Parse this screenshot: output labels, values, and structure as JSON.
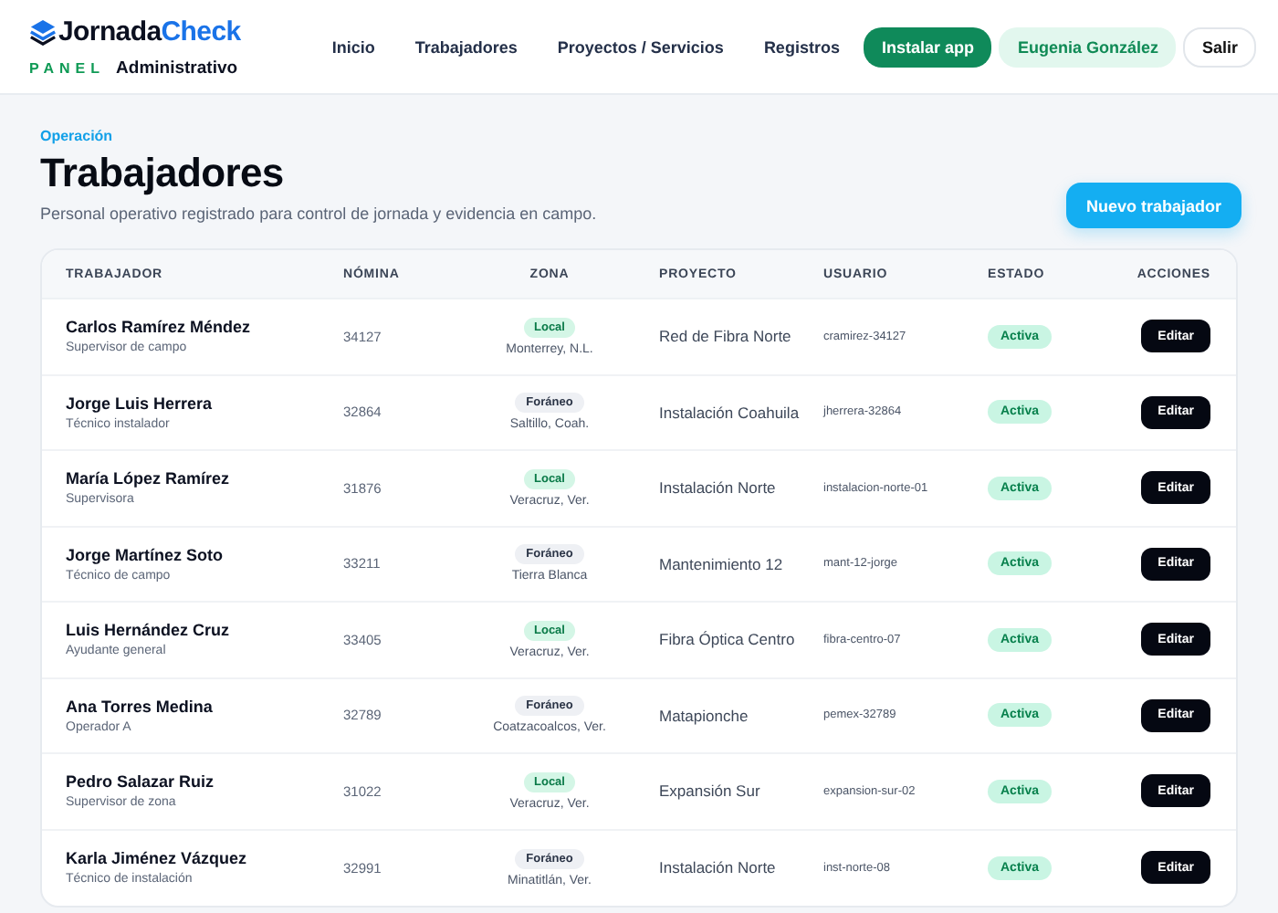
{
  "brand": {
    "name_start": "Jornada",
    "name_end": "Check",
    "panel": "PANEL",
    "subtitle": "Administrativo"
  },
  "nav": [
    {
      "label": "Inicio",
      "kind": "link"
    },
    {
      "label": "Trabajadores",
      "kind": "link"
    },
    {
      "label": "Proyectos / Servicios",
      "kind": "link"
    },
    {
      "label": "Registros",
      "kind": "link"
    },
    {
      "label": "Instalar app",
      "kind": "primary"
    },
    {
      "label": "Eugenia González",
      "kind": "user"
    },
    {
      "label": "Salir",
      "kind": "outline"
    }
  ],
  "page": {
    "eyebrow": "Operación",
    "title": "Trabajadores",
    "description": "Personal operativo registrado para control de jornada y evidencia en campo.",
    "action": "Nuevo trabajador"
  },
  "table": {
    "columns": [
      "TRABAJADOR",
      "NÓMINA",
      "ZONA",
      "PROYECTO",
      "USUARIO",
      "ESTADO",
      "ACCIONES"
    ],
    "rows": [
      {
        "name": "Carlos Ramírez Méndez",
        "role": "Supervisor de campo",
        "payroll": "34127",
        "zone": {
          "label": "Local",
          "kind": "local"
        },
        "place": "Monterrey, N.L.",
        "project": "Red de Fibra Norte",
        "user": "cramirez-34127",
        "status": {
          "label": "Activa",
          "kind": "active"
        },
        "action": "Editar"
      },
      {
        "name": "Jorge Luis Herrera",
        "role": "Técnico instalador",
        "payroll": "32864",
        "zone": {
          "label": "Foráneo",
          "kind": "foreign"
        },
        "place": "Saltillo, Coah.",
        "project": "Instalación Coahuila",
        "user": "jherrera-32864",
        "status": {
          "label": "Activa",
          "kind": "active"
        },
        "action": "Editar"
      },
      {
        "name": "María López Ramírez",
        "role": "Supervisora",
        "payroll": "31876",
        "zone": {
          "label": "Local",
          "kind": "local"
        },
        "place": "Veracruz, Ver.",
        "project": "Instalación Norte",
        "user": "instalacion-norte-01",
        "status": {
          "label": "Activa",
          "kind": "active"
        },
        "action": "Editar"
      },
      {
        "name": "Jorge Martínez Soto",
        "role": "Técnico de campo",
        "payroll": "33211",
        "zone": {
          "label": "Foráneo",
          "kind": "foreign"
        },
        "place": "Tierra Blanca",
        "project": "Mantenimiento 12",
        "user": "mant-12-jorge",
        "status": {
          "label": "Activa",
          "kind": "active"
        },
        "action": "Editar"
      },
      {
        "name": "Luis Hernández Cruz",
        "role": "Ayudante general",
        "payroll": "33405",
        "zone": {
          "label": "Local",
          "kind": "local"
        },
        "place": "Veracruz, Ver.",
        "project": "Fibra Óptica Centro",
        "user": "fibra-centro-07",
        "status": {
          "label": "Activa",
          "kind": "active"
        },
        "action": "Editar"
      },
      {
        "name": "Ana Torres Medina",
        "role": "Operador A",
        "payroll": "32789",
        "zone": {
          "label": "Foráneo",
          "kind": "foreign"
        },
        "place": "Coatzacoalcos, Ver.",
        "project": "Matapionche",
        "user": "pemex-32789",
        "status": {
          "label": "Activa",
          "kind": "active"
        },
        "action": "Editar"
      },
      {
        "name": "Pedro Salazar Ruiz",
        "role": "Supervisor de zona",
        "payroll": "31022",
        "zone": {
          "label": "Local",
          "kind": "local"
        },
        "place": "Veracruz, Ver.",
        "project": "Expansión Sur",
        "user": "expansion-sur-02",
        "status": {
          "label": "Activa",
          "kind": "active"
        },
        "action": "Editar"
      },
      {
        "name": "Karla Jiménez Vázquez",
        "role": "Técnico de instalación",
        "payroll": "32991",
        "zone": {
          "label": "Foráneo",
          "kind": "foreign"
        },
        "place": "Minatitlán, Ver.",
        "project": "Instalación Norte",
        "user": "inst-norte-08",
        "status": {
          "label": "Activa",
          "kind": "active"
        },
        "action": "Editar"
      }
    ]
  }
}
